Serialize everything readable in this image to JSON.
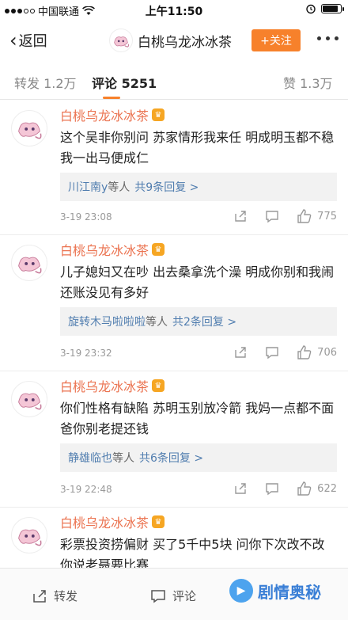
{
  "status_bar": {
    "carrier": "中国联通",
    "time": "上午11:50"
  },
  "nav": {
    "back_label": "返回",
    "title": "白桃乌龙冰冰茶",
    "follow_label": "+关注"
  },
  "tabs": {
    "reposts": "转发 1.2万",
    "comments": "评论 5251",
    "likes": "赞 1.3万"
  },
  "comments": [
    {
      "author": "白桃乌龙冰冰茶",
      "text": "这个吴非你别问 苏家情形我来任 明成明玉都不稳 我一出马便成仁",
      "reply_users": "川江南y",
      "reply_mid": "等人",
      "reply_count": "共9条回复 >",
      "time": "3-19 23:08",
      "likes": "775"
    },
    {
      "author": "白桃乌龙冰冰茶",
      "text": "儿子媳妇又在吵 出去桑拿洗个澡 明成你别和我闹 还账没见有多好",
      "reply_users": "旋转木马啦啦啦",
      "reply_mid": "等人",
      "reply_count": "共2条回复 >",
      "time": "3-19 23:32",
      "likes": "706"
    },
    {
      "author": "白桃乌龙冰冰茶",
      "text": "你们性格有缺陷 苏明玉别放冷箭 我妈一点都不面 爸你别老提还钱",
      "reply_users": "静雄临也",
      "reply_mid": "等人",
      "reply_count": "共6条回复 >",
      "time": "3-19 22:48",
      "likes": "622"
    },
    {
      "author": "白桃乌龙冰冰茶",
      "text": "彩票投资捞偏财 买了5千中5块 问你下次改不改 你说老聂要比赛"
    }
  ],
  "bottom_bar": {
    "repost": "转发",
    "comment": "评论"
  },
  "watermark": {
    "text": "剧情奥秘"
  },
  "colors": {
    "accent_orange": "#f7812b",
    "author_name": "#eb7350",
    "link_blue": "#507daf"
  }
}
